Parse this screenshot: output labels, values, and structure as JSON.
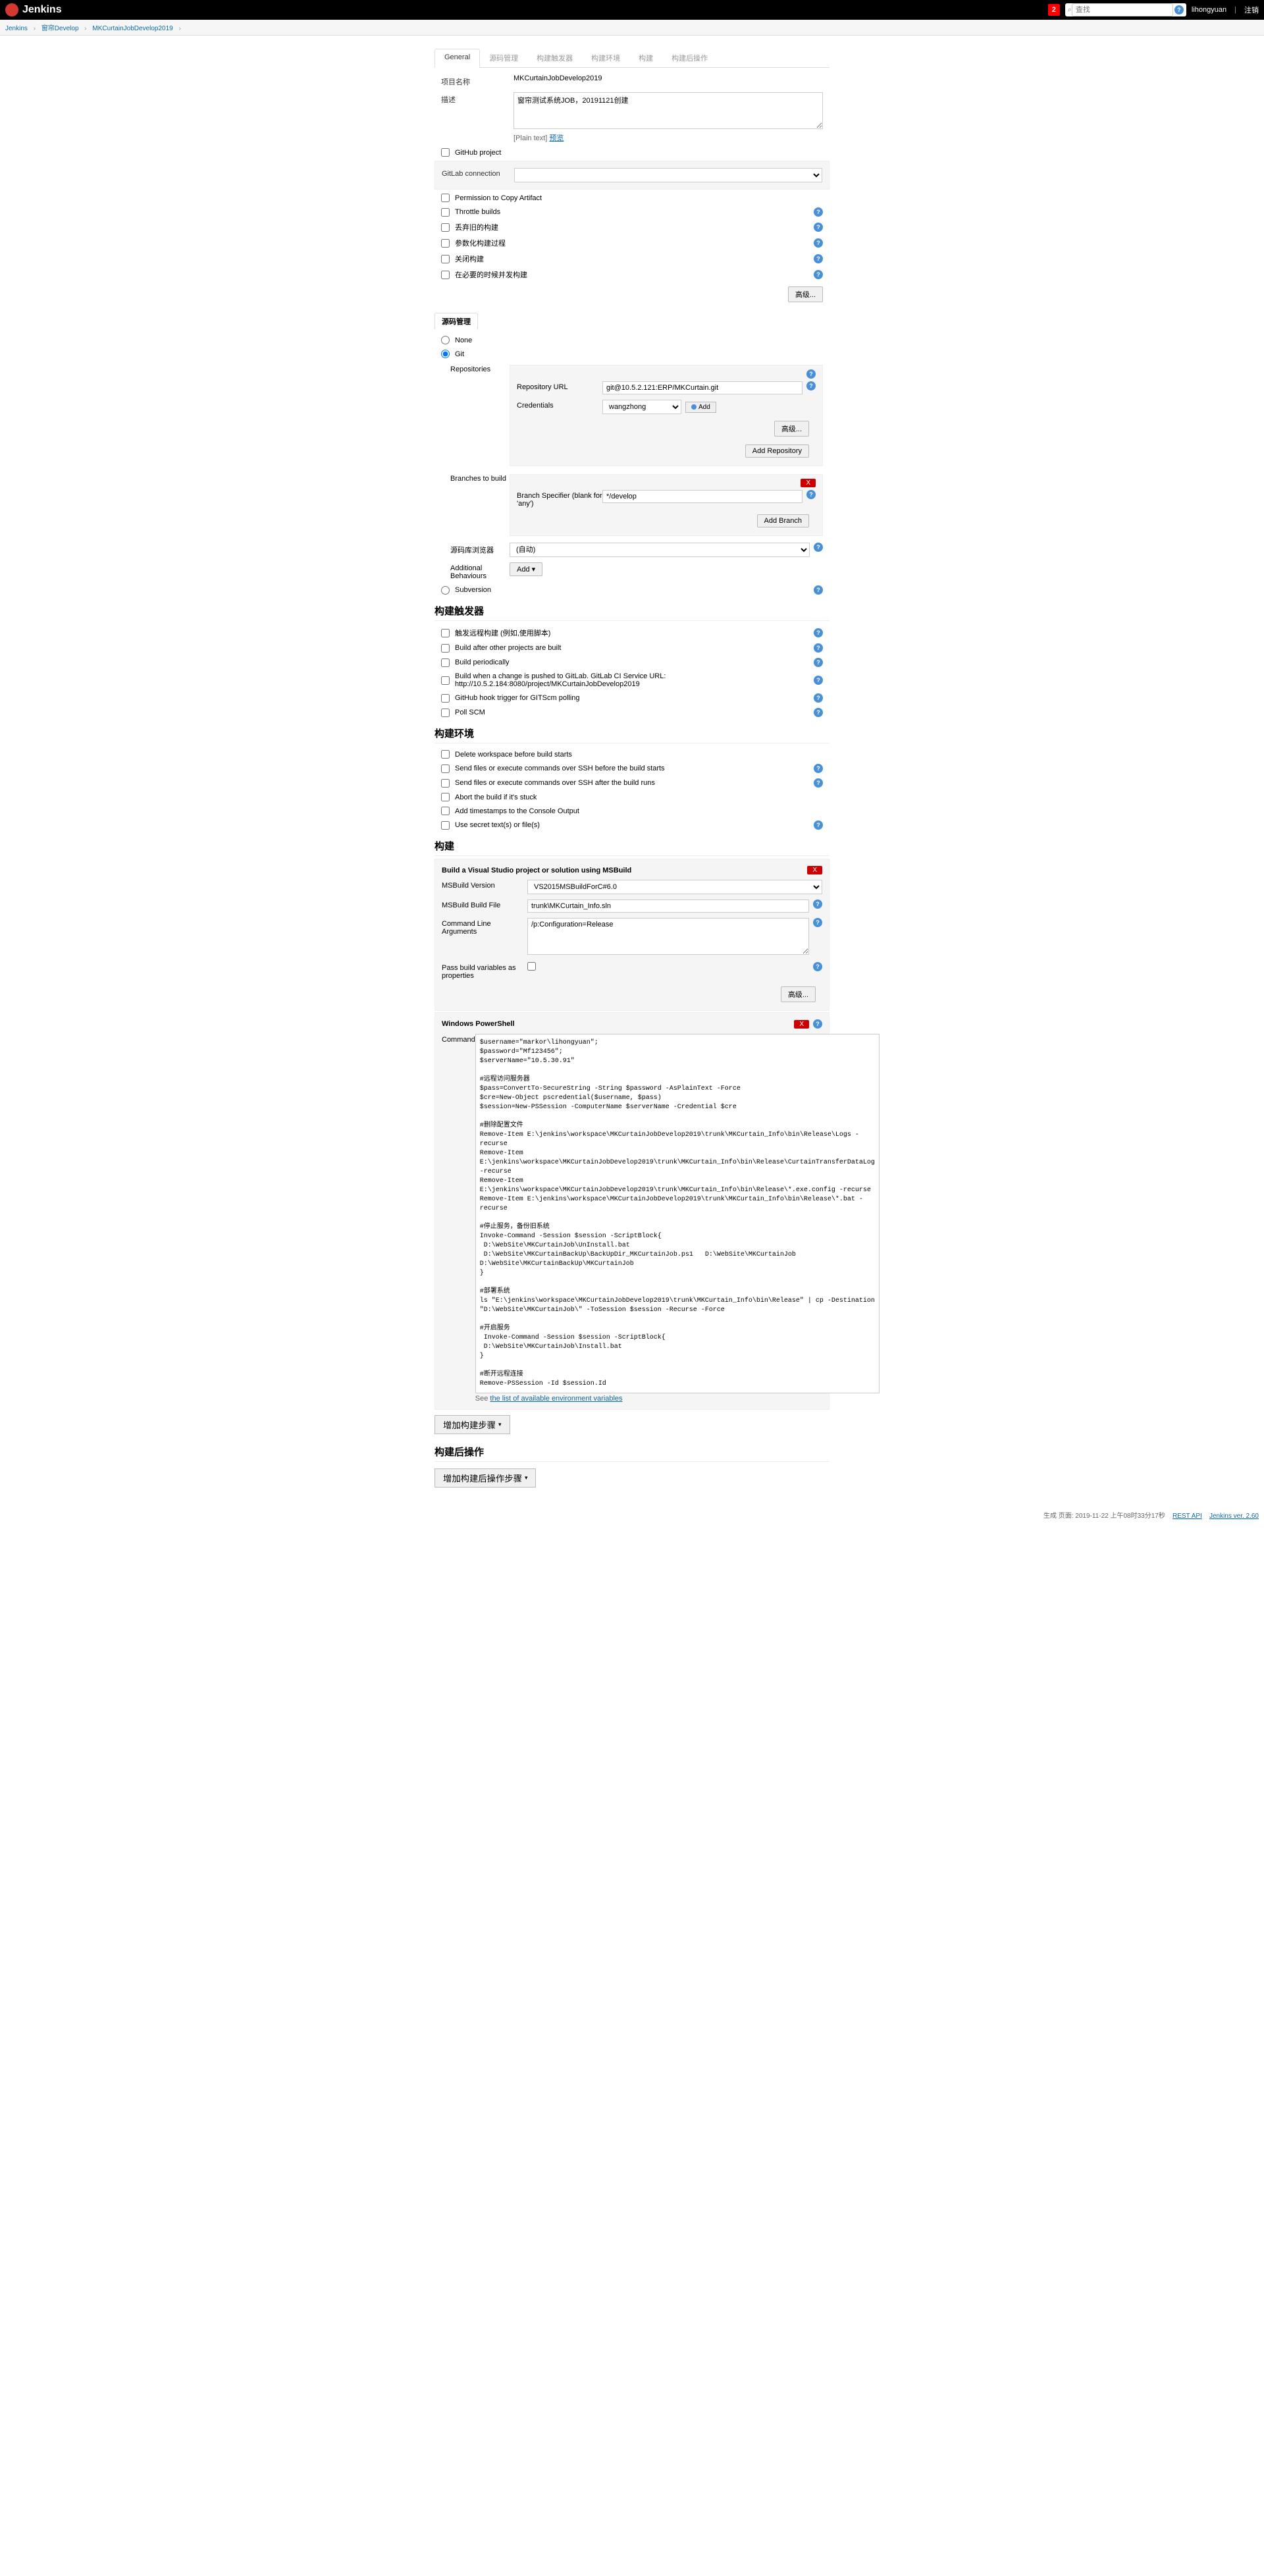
{
  "header": {
    "logo_text": "Jenkins",
    "notification_count": "2",
    "search_placeholder": "查找",
    "user": "lihongyuan",
    "logout": "注销"
  },
  "breadcrumb": {
    "items": [
      "Jenkins",
      "窗帘Develop",
      "MKCurtainJobDevelop2019"
    ]
  },
  "tabs": [
    "General",
    "源码管理",
    "构建触发器",
    "构建环境",
    "构建",
    "构建后操作"
  ],
  "general": {
    "project_name_label": "项目名称",
    "project_name": "MKCurtainJobDevelop2019",
    "description_label": "描述",
    "description": "窗帘测试系统JOB，20191121创建",
    "plain_text_label": "[Plain text]",
    "preview_link": "预览",
    "github_project": "GitHub project",
    "gitlab_connection_label": "GitLab connection",
    "permission_copy": "Permission to Copy Artifact",
    "throttle_builds": "Throttle builds",
    "discard_old": "丢弃旧的构建",
    "parameterize": "参数化构建过程",
    "close_build": "关闭构建",
    "concurrent": "在必要的时候并发构建",
    "advanced_btn": "高级..."
  },
  "scm": {
    "title": "源码管理",
    "none": "None",
    "git": "Git",
    "repositories_label": "Repositories",
    "repo_url_label": "Repository URL",
    "repo_url": "git@10.5.2.121:ERP/MKCurtain.git",
    "credentials_label": "Credentials",
    "credentials_value": "wangzhong",
    "add_btn": "Add",
    "advanced_btn": "高级...",
    "add_repo_btn": "Add Repository",
    "branches_label": "Branches to build",
    "branch_specifier_label": "Branch Specifier (blank for 'any')",
    "branch_specifier": "*/develop",
    "add_branch_btn": "Add Branch",
    "browser_label": "源码库浏览器",
    "browser_value": "(自动)",
    "additional_label": "Additional Behaviours",
    "add_dropdown": "Add",
    "subversion": "Subversion",
    "delete_x": "X"
  },
  "triggers": {
    "title": "构建触发器",
    "remote": "触发远程构建 (例如,使用脚本)",
    "after_other": "Build after other projects are built",
    "periodically": "Build periodically",
    "gitlab_push": "Build when a change is pushed to GitLab. GitLab CI Service URL: http://10.5.2.184:8080/project/MKCurtainJobDevelop2019",
    "github_hook": "GitHub hook trigger for GITScm polling",
    "poll_scm": "Poll SCM"
  },
  "env": {
    "title": "构建环境",
    "delete_ws": "Delete workspace before build starts",
    "ssh_before": "Send files or execute commands over SSH before the build starts",
    "ssh_after": "Send files or execute commands over SSH after the build runs",
    "abort_stuck": "Abort the build if it's stuck",
    "timestamps": "Add timestamps to the Console Output",
    "secret_text": "Use secret text(s) or file(s)"
  },
  "build": {
    "title": "构建",
    "msbuild_title": "Build a Visual Studio project or solution using MSBuild",
    "msbuild_version_label": "MSBuild Version",
    "msbuild_version": "VS2015MSBuildForC#6.0",
    "build_file_label": "MSBuild Build File",
    "build_file": "trunk\\MKCurtain_Info.sln",
    "cmd_args_label": "Command Line Arguments",
    "cmd_args": "/p:Configuration=Release",
    "pass_vars_label": "Pass build variables as properties",
    "advanced_btn": "高级...",
    "powershell_title": "Windows PowerShell",
    "command_label": "Command",
    "powershell_script": "$username=\"markor\\lihongyuan\";\n$password=\"Mf123456\";\n$serverName=\"10.5.30.91\"\n\n#远程访问服务器\n$pass=ConvertTo-SecureString -String $password -AsPlainText -Force\n$cre=New-Object pscredential($username, $pass)\n$session=New-PSSession -ComputerName $serverName -Credential $cre\n\n#删除配置文件\nRemove-Item E:\\jenkins\\workspace\\MKCurtainJobDevelop2019\\trunk\\MKCurtain_Info\\bin\\Release\\Logs -recurse\nRemove-Item E:\\jenkins\\workspace\\MKCurtainJobDevelop2019\\trunk\\MKCurtain_Info\\bin\\Release\\CurtainTransferDataLog -recurse\nRemove-Item E:\\jenkins\\workspace\\MKCurtainJobDevelop2019\\trunk\\MKCurtain_Info\\bin\\Release\\*.exe.config -recurse\nRemove-Item E:\\jenkins\\workspace\\MKCurtainJobDevelop2019\\trunk\\MKCurtain_Info\\bin\\Release\\*.bat -recurse\n\n#停止服务，备份旧系统\nInvoke-Command -Session $session -ScriptBlock{\n D:\\WebSite\\MKCurtainJob\\UnInstall.bat\n D:\\WebSite\\MKCurtainBackUp\\BackUpDir_MKCurtainJob.ps1   D:\\WebSite\\MKCurtainJob  D:\\WebSite\\MKCurtainBackUp\\MKCurtainJob\n}\n\n#部署系统\nls \"E:\\jenkins\\workspace\\MKCurtainJobDevelop2019\\trunk\\MKCurtain_Info\\bin\\Release\" | cp -Destination \"D:\\WebSite\\MKCurtainJob\\\" -ToSession $session -Recurse -Force\n\n#开启服务\n Invoke-Command -Session $session -ScriptBlock{\n D:\\WebSite\\MKCurtainJob\\Install.bat\n}\n\n#断开远程连接\nRemove-PSSession -Id $session.Id",
    "see_label": "See ",
    "env_vars_link": "the list of available environment variables",
    "add_step_btn": "增加构建步骤",
    "delete_x": "X"
  },
  "post": {
    "title": "构建后操作",
    "add_post_btn": "增加构建后操作步骤"
  },
  "footer": {
    "gen_text": "生成 页面: 2019-11-22 上午08时33分17秒",
    "rest_api": "REST API",
    "version": "Jenkins ver. 2.60"
  }
}
